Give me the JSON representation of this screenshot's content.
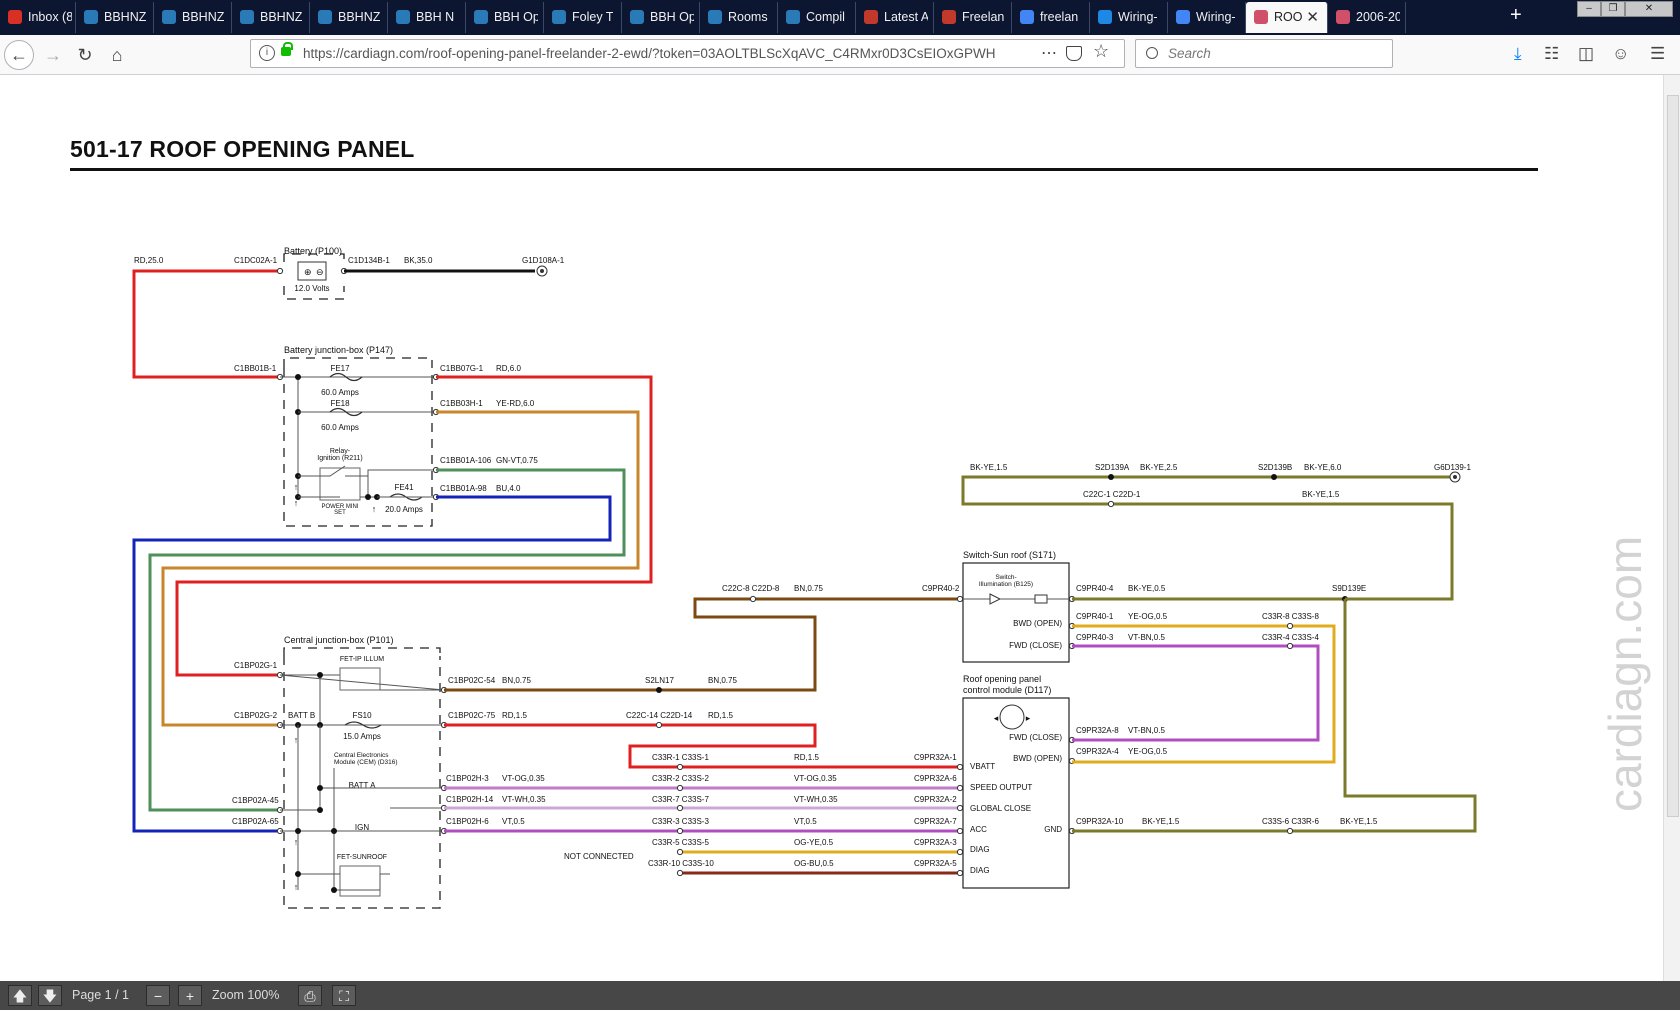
{
  "tabs": [
    {
      "label": "Inbox (8",
      "icon": "gmail-icon",
      "color": "#d93025"
    },
    {
      "label": "BBHNZ",
      "icon": "globe-icon",
      "color": "#2a7ab8"
    },
    {
      "label": "BBHNZ",
      "icon": "globe-icon",
      "color": "#2a7ab8"
    },
    {
      "label": "BBHNZ",
      "icon": "globe-icon",
      "color": "#2a7ab8"
    },
    {
      "label": "BBHNZ",
      "icon": "globe-icon",
      "color": "#2a7ab8"
    },
    {
      "label": "BBH N",
      "icon": "globe-icon",
      "color": "#2a7ab8"
    },
    {
      "label": "BBH Op",
      "icon": "globe-icon",
      "color": "#2a7ab8"
    },
    {
      "label": "Foley T",
      "icon": "globe-icon",
      "color": "#2a7ab8"
    },
    {
      "label": "BBH Op",
      "icon": "globe-icon",
      "color": "#2a7ab8"
    },
    {
      "label": "Rooms",
      "icon": "globe-icon",
      "color": "#2a7ab8"
    },
    {
      "label": "Compil",
      "icon": "globe-icon",
      "color": "#2a7ab8"
    },
    {
      "label": "Latest A",
      "icon": "car-icon",
      "color": "#c0392b"
    },
    {
      "label": "Freelan",
      "icon": "car-icon",
      "color": "#c0392b"
    },
    {
      "label": "freelan",
      "icon": "google-icon",
      "color": "#4285f4"
    },
    {
      "label": "Wiring-",
      "icon": "s-icon",
      "color": "#1e88e5"
    },
    {
      "label": "Wiring-",
      "icon": "google-icon",
      "color": "#4285f4"
    },
    {
      "label": "ROO",
      "icon": "pdf-icon",
      "color": "#d0506a"
    },
    {
      "label": "2006-20",
      "icon": "pdf-icon",
      "color": "#d0506a"
    }
  ],
  "url": "https://cardiagn.com/roof-opening-panel-freelander-2-ewd/?token=03AOLTBLScXqAVC_C4RMxr0D3CsEIOxGPWH",
  "search_placeholder": "Search",
  "title": "501-17 ROOF OPENING PANEL",
  "watermark": "cardiagn.com",
  "viewer": {
    "page_label": "Page 1 / 1",
    "zoom_label": "Zoom 100%"
  },
  "colors": {
    "red": "#e02020",
    "yellow_red": "#c8862c",
    "green": "#4f8f5a",
    "blue": "#1524b8",
    "brown": "#7a4a12",
    "olive": "#7b7a2b",
    "violet": "#b04dc0",
    "vt_og": "#c27bc8",
    "vt_wh": "#c9a8d8",
    "og_ye": "#e0ac1c",
    "og_bu": "#8a2a18",
    "black": "#111111"
  },
  "components": {
    "battery": {
      "name": "Battery (P100)",
      "voltage": "12.0 Volts"
    },
    "bjb": {
      "name": "Battery junction-box (P147)",
      "fe17": "FE17",
      "fe17_amps": "60.0 Amps",
      "fe18": "FE18",
      "fe18_amps": "60.0 Amps",
      "relay": "Relay-\nIgnition (R211)",
      "relay_line1": "Relay-",
      "relay_line2": "Ignition (R211)",
      "power_mini": "POWER MINI",
      "power_set": "SET",
      "fe41": "FE41",
      "fe41_amps": "20.0 Amps"
    },
    "cjb": {
      "name": "Central junction-box (P101)",
      "fet_ip": "FET-IP ILLUM",
      "fs10": "FS10",
      "fs10_amps": "15.0 Amps",
      "cem1": "Central Electronics",
      "cem2": "Module (CEM) (D316)",
      "batt_a": "BATT A",
      "batt_b": "BATT B",
      "ign": "IGN",
      "fet_sunroof": "FET-SUNROOF"
    },
    "switch": {
      "name": "Switch-Sun roof (S171)",
      "illum1": "Switch-",
      "illum2": "Illumination (B125)",
      "bwd": "BWD (OPEN)",
      "fwd": "FWD (CLOSE)"
    },
    "module": {
      "name1": "Roof opening panel",
      "name2": "control module (D117)",
      "fwd": "FWD (CLOSE)",
      "bwd": "BWD (OPEN)",
      "vbatt": "VBATT",
      "speed": "SPEED OUTPUT",
      "global": "GLOBAL CLOSE",
      "acc": "ACC",
      "gnd": "GND",
      "diag1": "DIAG",
      "diag2": "DIAG"
    }
  },
  "labels": {
    "rd25": "RD,25.0",
    "c1dc02a": "C1DC02A-1",
    "c1d134b": "C1D134B-1",
    "bk35": "BK,35.0",
    "g1d108a": "G1D108A-1",
    "c1bb01b": "C1BB01B-1",
    "c1bb07g": "C1BB07G-1",
    "rd6": "RD,6.0",
    "c1bb03h": "C1BB03H-1",
    "yerd6": "YE-RD,6.0",
    "c1bb01a106": "C1BB01A-106",
    "gnvt": "GN-VT,0.75",
    "c1bb01a98": "C1BB01A-98",
    "bu4": "BU,4.0",
    "c1bp02g1": "C1BP02G-1",
    "c1bp02g2": "C1BP02G-2",
    "c1bp02a45": "C1BP02A-45",
    "c1bp02a65": "C1BP02A-65",
    "c1bp02c54": "C1BP02C-54",
    "bn075a": "BN,0.75",
    "s2ln17": "S2LN17",
    "bn075b": "BN,0.75",
    "c1bp02c75": "C1BP02C-75",
    "rd15a": "RD,1.5",
    "c22c14": "C22C-14 C22D-14",
    "rd15b": "RD,1.5",
    "c1bp02h3": "C1BP02H-3",
    "vtog035": "VT-OG,0.35",
    "c1bp02h14": "C1BP02H-14",
    "vtwh035": "VT-WH,0.35",
    "c1bp02h6": "C1BP02H-6",
    "vt05": "VT,0.5",
    "c33r1": "C33R-1 C33S-1",
    "rd15c": "RD,1.5",
    "c9pr32a1": "C9PR32A-1",
    "c33r2": "C33R-2 C33S-2",
    "vtog035b": "VT-OG,0.35",
    "c9pr32a6": "C9PR32A-6",
    "c33r7": "C33R-7 C33S-7",
    "vtwh035b": "VT-WH,0.35",
    "c9pr32a2": "C9PR32A-2",
    "c33r3": "C33R-3 C33S-3",
    "vt05b": "VT,0.5",
    "c9pr32a7": "C9PR32A-7",
    "c33r5": "C33R-5 C33S-5",
    "ogye": "OG-YE,0.5",
    "c9pr32a3": "C9PR32A-3",
    "c33r10": "C33R-10 C33S-10",
    "ogbu": "OG-BU,0.5",
    "c9pr32a5": "C9PR32A-5",
    "not_connected": "NOT CONNECTED",
    "c22c8": "C22C-8 C22D-8",
    "bn075c": "BN,0.75",
    "c9pr40_2": "C9PR40-2",
    "c9pr40_4": "C9PR40-4",
    "bkye05": "BK-YE,0.5",
    "s9d139e": "S9D139E",
    "c9pr40_1": "C9PR40-1",
    "yeog05": "YE-OG,0.5",
    "c33r8": "C33R-8 C33S-8",
    "c9pr40_3": "C9PR40-3",
    "vtbn05": "VT-BN,0.5",
    "c33r4": "C33R-4 C33S-4",
    "c9pr32a8": "C9PR32A-8",
    "vtbn05b": "VT-BN,0.5",
    "c9pr32a4": "C9PR32A-4",
    "yeog05b": "YE-OG,0.5",
    "c9pr32a10": "C9PR32A-10",
    "bkye15a": "BK-YE,1.5",
    "c33s6": "C33S-6 C33R-6",
    "bkye15b": "BK-YE,1.5",
    "bkye15top": "BK-YE,1.5",
    "s2d139a": "S2D139A",
    "bkye25": "BK-YE,2.5",
    "s2d139b": "S2D139B",
    "bkye6": "BK-YE,6.0",
    "g6d139": "G6D139-1",
    "c22c1": "C22C-1 C22D-1",
    "bkye15c": "BK-YE,1.5"
  }
}
